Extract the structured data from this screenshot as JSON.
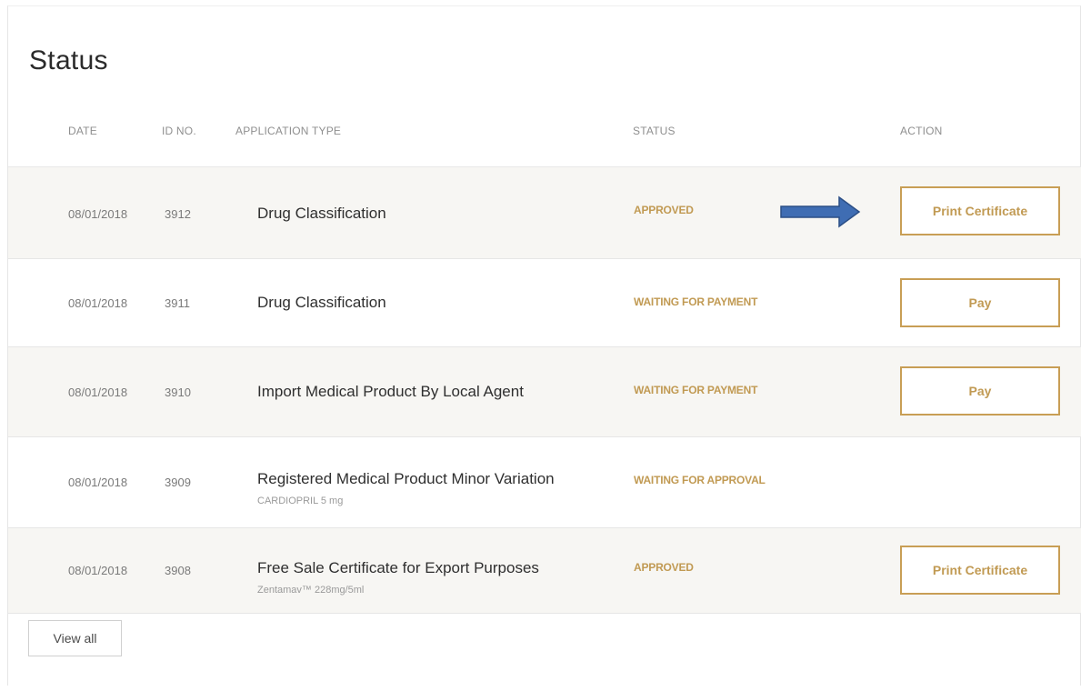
{
  "page": {
    "title": "Status"
  },
  "table": {
    "headers": {
      "date": "DATE",
      "id": "ID NO.",
      "type": "APPLICATION TYPE",
      "status": "STATUS",
      "action": "ACTION"
    },
    "rows": [
      {
        "date": "08/01/2018",
        "id": "3912",
        "type": "Drug Classification",
        "subtitle": "",
        "status": "APPROVED",
        "action": "Print Certificate"
      },
      {
        "date": "08/01/2018",
        "id": "3911",
        "type": "Drug Classification",
        "subtitle": "",
        "status": "WAITING FOR PAYMENT",
        "action": "Pay"
      },
      {
        "date": "08/01/2018",
        "id": "3910",
        "type": "Import Medical Product By Local Agent",
        "subtitle": "",
        "status": "WAITING FOR PAYMENT",
        "action": "Pay"
      },
      {
        "date": "08/01/2018",
        "id": "3909",
        "type": "Registered Medical Product Minor Variation",
        "subtitle": "CARDIOPRIL 5 mg",
        "status": "WAITING FOR APPROVAL",
        "action": ""
      },
      {
        "date": "08/01/2018",
        "id": "3908",
        "type": "Free Sale Certificate for Export Purposes",
        "subtitle": "Zentamav™ 228mg/5ml",
        "status": "APPROVED",
        "action": "Print Certificate"
      }
    ]
  },
  "footer": {
    "view_all_label": "View all"
  },
  "annotation": {
    "icon": "right-arrow-icon",
    "color": "#3f6db3"
  },
  "colors": {
    "accent": "#c19a53",
    "row_shade": "#f7f6f3"
  }
}
